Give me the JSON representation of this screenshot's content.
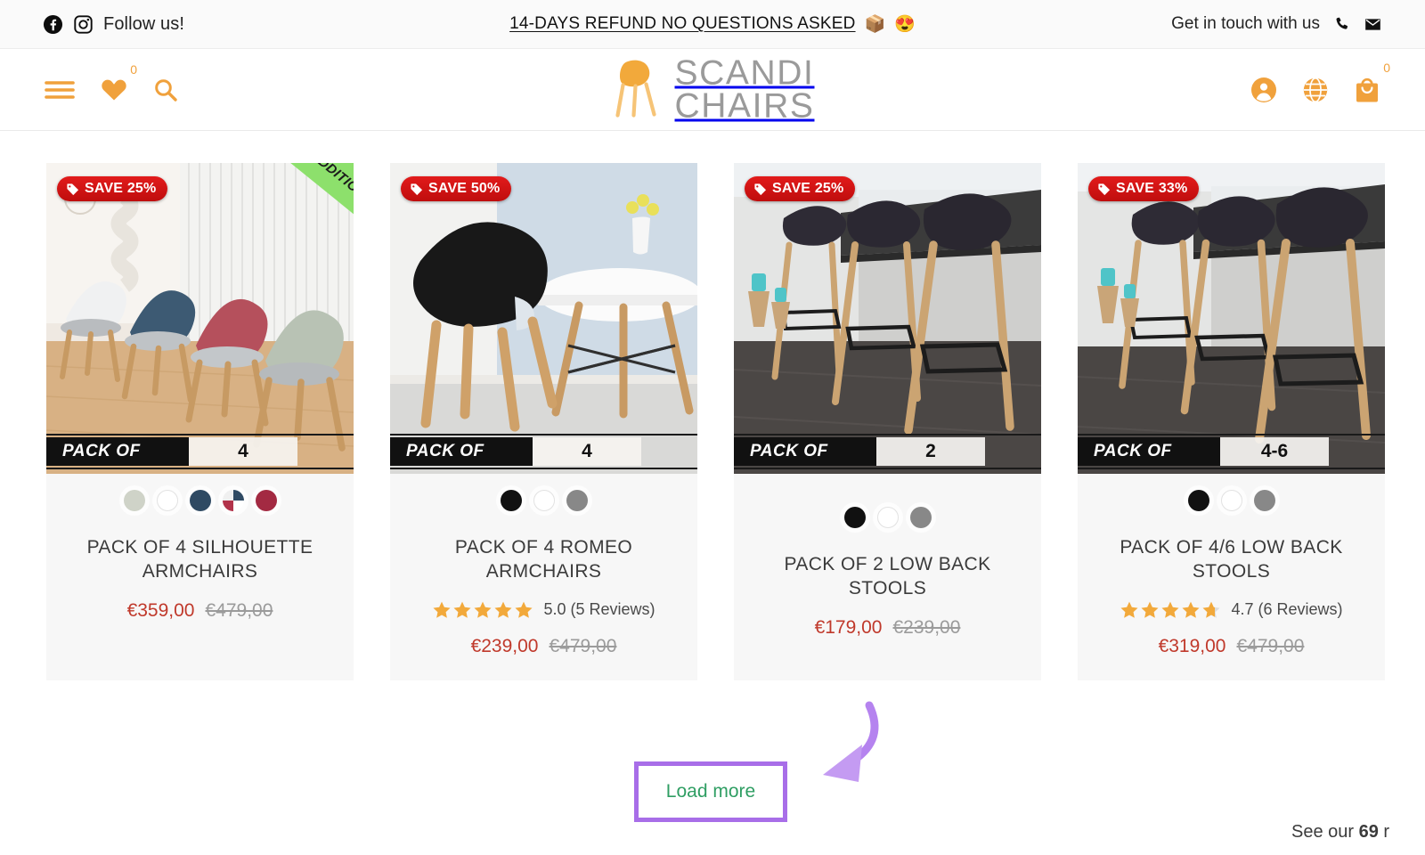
{
  "announcement": {
    "facebook_icon": "facebook-icon",
    "instagram_icon": "instagram-icon",
    "follow_label": "Follow us!",
    "refund_text": "14-DAYS REFUND NO QUESTIONS ASKED",
    "emoji_package": "📦",
    "emoji_heart_eyes": "😍",
    "contact_label": "Get in touch with us",
    "phone_icon": "phone-icon",
    "mail_icon": "mail-icon"
  },
  "header": {
    "menu_icon": "hamburger-menu-icon",
    "wishlist_icon": "heart-icon",
    "wishlist_count": "0",
    "search_icon": "search-icon",
    "logo_line1": "SCANDI",
    "logo_line2": "CHAIRS",
    "account_icon": "user-account-icon",
    "language_icon": "globe-icon",
    "cart_icon": "shopping-bag-icon",
    "cart_count": "0"
  },
  "colors": {
    "accent_orange": "#f0a13c",
    "sale_red": "#c0392b",
    "badge_red": "#d11717",
    "ribbon_green": "#8de06c",
    "annotation_purple": "#a86ee8",
    "loadmore_green": "#2f9e63",
    "card_bg": "#f7f7f7"
  },
  "products": [
    {
      "save_badge": "SAVE 25%",
      "ribbon": "New Addition",
      "pack_label": "PACK OF",
      "pack_value": "4",
      "swatches": [
        "#cfd3c8",
        "#ffffff",
        "#2f4a63",
        "multi",
        "#a32a42"
      ],
      "title": "PACK OF 4 SILHOUETTE ARMCHAIRS",
      "rating": null,
      "rating_text": "",
      "price_now": "€359,00",
      "price_old": "€479,00"
    },
    {
      "save_badge": "SAVE 50%",
      "ribbon": null,
      "pack_label": "PACK OF",
      "pack_value": "4",
      "swatches": [
        "#111111",
        "#ffffff",
        "#888888"
      ],
      "title": "PACK OF 4 ROMEO ARMCHAIRS",
      "rating": 5.0,
      "rating_text": "5.0 (5 Reviews)",
      "price_now": "€239,00",
      "price_old": "€479,00"
    },
    {
      "save_badge": "SAVE 25%",
      "ribbon": null,
      "pack_label": "PACK OF",
      "pack_value": "2",
      "swatches": [
        "#111111",
        "#ffffff",
        "#888888"
      ],
      "title": "PACK OF 2 LOW BACK STOOLS",
      "rating": null,
      "rating_text": "",
      "price_now": "€179,00",
      "price_old": "€239,00"
    },
    {
      "save_badge": "SAVE 33%",
      "ribbon": null,
      "pack_label": "PACK OF",
      "pack_value": "4-6",
      "swatches": [
        "#111111",
        "#ffffff",
        "#888888"
      ],
      "title": "PACK OF 4/6 LOW BACK STOOLS",
      "rating": 4.7,
      "rating_text": "4.7 (6 Reviews)",
      "price_now": "€319,00",
      "price_old": "€479,00"
    }
  ],
  "load_more": {
    "label": "Load more",
    "annotation_arrow_icon": "curved-arrow-icon"
  },
  "trustpilot": {
    "prefix": "See our ",
    "count": "69",
    "suffix": " r"
  }
}
